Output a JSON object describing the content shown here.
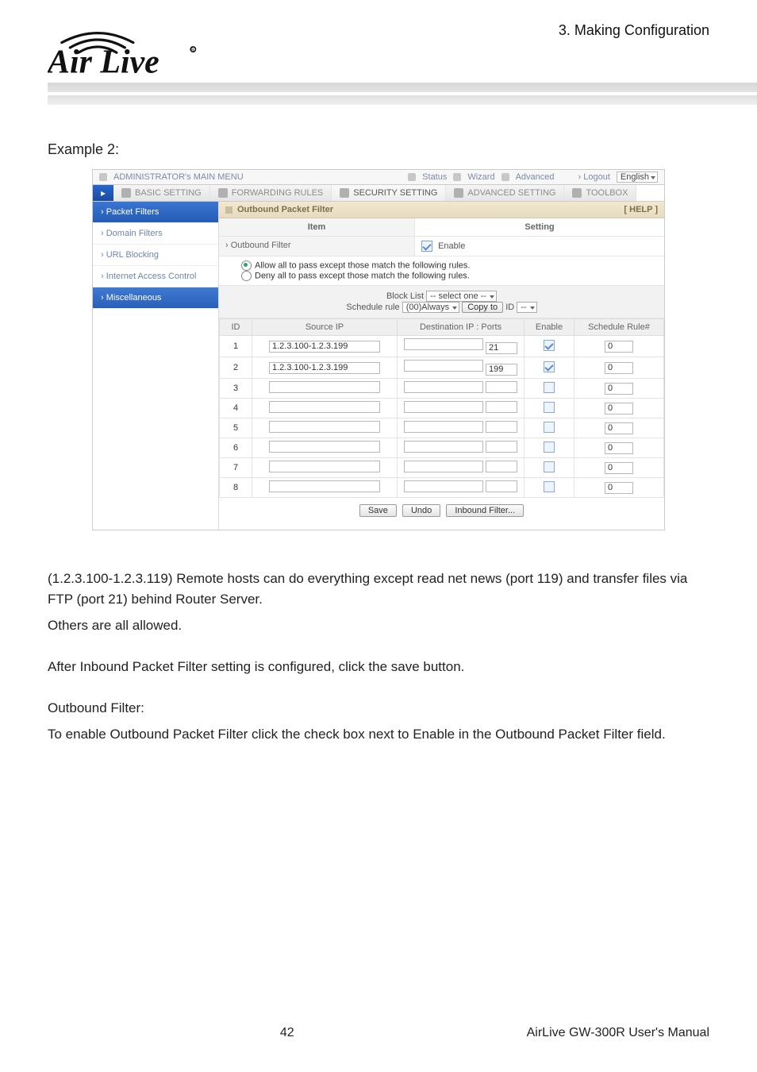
{
  "header": {
    "chapter": "3.  Making  Configuration"
  },
  "example_label": "Example 2:",
  "shot": {
    "topbar": {
      "main_menu": "ADMINISTRATOR's MAIN MENU",
      "status": "Status",
      "wizard": "Wizard",
      "advanced": "Advanced",
      "logout": "Logout",
      "language": "English"
    },
    "tabs": {
      "basic": "BASIC SETTING",
      "forwarding": "FORWARDING RULES",
      "security": "SECURITY SETTING",
      "advanced": "ADVANCED SETTING",
      "toolbox": "TOOLBOX"
    },
    "sidebar": {
      "items": [
        "Packet Filters",
        "Domain Filters",
        "URL Blocking",
        "Internet Access Control",
        "Miscellaneous"
      ]
    },
    "panel": {
      "title": "Outbound Packet Filter",
      "help": "[ HELP ]",
      "item_label": "Item",
      "setting_label": "Setting",
      "outbound_filter_label": "Outbound Filter",
      "enable_label": "Enable",
      "allow_label": "Allow all to pass except those match the following rules.",
      "deny_label": "Deny all to pass except those match the following rules.",
      "block_list_label": "Block List",
      "block_list_value": "-- select one --",
      "schedule_rule_label": "Schedule rule",
      "schedule_rule_value": "(00)Always",
      "copy_to_label": "Copy to",
      "copy_to_id_label": "ID",
      "copy_to_id_value": "--",
      "table": {
        "headers": {
          "id": "ID",
          "source": "Source IP",
          "dest": "Destination IP : Ports",
          "enable": "Enable",
          "sched": "Schedule Rule#"
        },
        "rows": [
          {
            "id": "1",
            "source": "1.2.3.100-1.2.3.199",
            "dest_ip": "",
            "dest_port": "21",
            "enable": true,
            "sched": "0"
          },
          {
            "id": "2",
            "source": "1.2.3.100-1.2.3.199",
            "dest_ip": "",
            "dest_port": "199",
            "enable": true,
            "sched": "0"
          },
          {
            "id": "3",
            "source": "",
            "dest_ip": "",
            "dest_port": "",
            "enable": false,
            "sched": "0"
          },
          {
            "id": "4",
            "source": "",
            "dest_ip": "",
            "dest_port": "",
            "enable": false,
            "sched": "0"
          },
          {
            "id": "5",
            "source": "",
            "dest_ip": "",
            "dest_port": "",
            "enable": false,
            "sched": "0"
          },
          {
            "id": "6",
            "source": "",
            "dest_ip": "",
            "dest_port": "",
            "enable": false,
            "sched": "0"
          },
          {
            "id": "7",
            "source": "",
            "dest_ip": "",
            "dest_port": "",
            "enable": false,
            "sched": "0"
          },
          {
            "id": "8",
            "source": "",
            "dest_ip": "",
            "dest_port": "",
            "enable": false,
            "sched": "0"
          }
        ]
      },
      "buttons": {
        "save": "Save",
        "undo": "Undo",
        "inbound": "Inbound Filter..."
      }
    }
  },
  "doc": {
    "p1": "(1.2.3.100-1.2.3.119) Remote hosts can do everything except read net news (port 119) and transfer files via FTP (port 21) behind Router Server.",
    "p2": "Others are all allowed.",
    "p3": "After Inbound Packet Filter setting is configured, click the save button.",
    "p4": "Outbound Filter:",
    "p5": "To enable Outbound Packet Filter click the check box next to Enable in the Outbound Packet Filter field."
  },
  "footer": {
    "page": "42",
    "manual": "AirLive GW-300R User's Manual"
  }
}
